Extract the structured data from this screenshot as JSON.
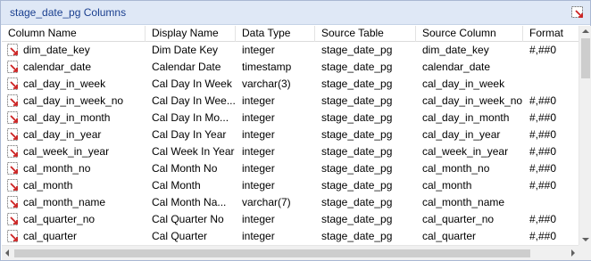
{
  "window": {
    "title": "stage_date_pg Columns"
  },
  "columns": [
    {
      "label": "Column Name"
    },
    {
      "label": "Display Name"
    },
    {
      "label": "Data Type"
    },
    {
      "label": "Source Table"
    },
    {
      "label": "Source Column"
    },
    {
      "label": "Format"
    }
  ],
  "rows": [
    {
      "name": "dim_date_key",
      "display": "Dim Date Key",
      "type": "integer",
      "table": "stage_date_pg",
      "source": "dim_date_key",
      "format": "#,##0"
    },
    {
      "name": "calendar_date",
      "display": "Calendar Date",
      "type": "timestamp",
      "table": "stage_date_pg",
      "source": "calendar_date",
      "format": ""
    },
    {
      "name": "cal_day_in_week",
      "display": "Cal Day In Week",
      "type": "varchar(3)",
      "table": "stage_date_pg",
      "source": "cal_day_in_week",
      "format": ""
    },
    {
      "name": "cal_day_in_week_no",
      "display": "Cal Day In Wee...",
      "type": "integer",
      "table": "stage_date_pg",
      "source": "cal_day_in_week_no",
      "format": "#,##0"
    },
    {
      "name": "cal_day_in_month",
      "display": "Cal Day In Mo...",
      "type": "integer",
      "table": "stage_date_pg",
      "source": "cal_day_in_month",
      "format": "#,##0"
    },
    {
      "name": "cal_day_in_year",
      "display": "Cal Day In Year",
      "type": "integer",
      "table": "stage_date_pg",
      "source": "cal_day_in_year",
      "format": "#,##0"
    },
    {
      "name": "cal_week_in_year",
      "display": "Cal Week In Year",
      "type": "integer",
      "table": "stage_date_pg",
      "source": "cal_week_in_year",
      "format": "#,##0"
    },
    {
      "name": "cal_month_no",
      "display": "Cal Month No",
      "type": "integer",
      "table": "stage_date_pg",
      "source": "cal_month_no",
      "format": "#,##0"
    },
    {
      "name": "cal_month",
      "display": "Cal Month",
      "type": "integer",
      "table": "stage_date_pg",
      "source": "cal_month",
      "format": "#,##0"
    },
    {
      "name": "cal_month_name",
      "display": "Cal Month Na...",
      "type": "varchar(7)",
      "table": "stage_date_pg",
      "source": "cal_month_name",
      "format": ""
    },
    {
      "name": "cal_quarter_no",
      "display": "Cal Quarter No",
      "type": "integer",
      "table": "stage_date_pg",
      "source": "cal_quarter_no",
      "format": "#,##0"
    },
    {
      "name": "cal_quarter",
      "display": "Cal Quarter",
      "type": "integer",
      "table": "stage_date_pg",
      "source": "cal_quarter",
      "format": "#,##0"
    }
  ],
  "icons": {
    "title_button": "window-menu-icon",
    "row_icon": "column-icon"
  },
  "colors": {
    "title_bg": "#dfe8f6",
    "title_text": "#1a3f8f",
    "icon_red": "#cc2222"
  }
}
